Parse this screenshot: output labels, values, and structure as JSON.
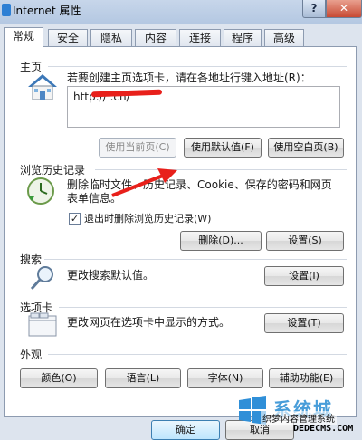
{
  "window": {
    "title": "Internet 属性",
    "help_label": "?",
    "close_label": "✕"
  },
  "tabs": [
    {
      "label": "常规",
      "active": true
    },
    {
      "label": "安全",
      "active": false
    },
    {
      "label": "隐私",
      "active": false
    },
    {
      "label": "内容",
      "active": false
    },
    {
      "label": "连接",
      "active": false
    },
    {
      "label": "程序",
      "active": false
    },
    {
      "label": "高级",
      "active": false
    }
  ],
  "homepage": {
    "title": "主页",
    "description": "若要创建主页选项卡，请在各地址行键入地址(R)：",
    "url_value": "http://        .cn/",
    "buttons": {
      "use_current": "使用当前页(C)",
      "use_default": "使用默认值(F)",
      "use_blank": "使用空白页(B)"
    }
  },
  "history": {
    "title": "浏览历史记录",
    "description_line1": "删除临时文件、历史记录、Cookie、保存的密码和网页",
    "description_line2": "表单信息。",
    "checkbox_label": "退出时删除浏览历史记录(W)",
    "checkbox_checked": "✓",
    "buttons": {
      "delete": "删除(D)...",
      "settings": "设置(S)"
    }
  },
  "search": {
    "title": "搜索",
    "description": "更改搜索默认值。",
    "settings_button": "设置(I)"
  },
  "tabs_section": {
    "title": "选项卡",
    "description": "更改网页在选项卡中显示的方式。",
    "settings_button": "设置(T)"
  },
  "appearance": {
    "title": "外观",
    "buttons": {
      "colors": "颜色(O)",
      "languages": "语言(L)",
      "fonts": "字体(N)",
      "accessibility": "辅助功能(E)"
    }
  },
  "footer": {
    "ok_label": "确定",
    "cancel_label": "取消"
  },
  "watermark": {
    "big_text": "系统城",
    "small_text": "织梦内容管理系统",
    "url_text": "DEDECMS.COM"
  }
}
